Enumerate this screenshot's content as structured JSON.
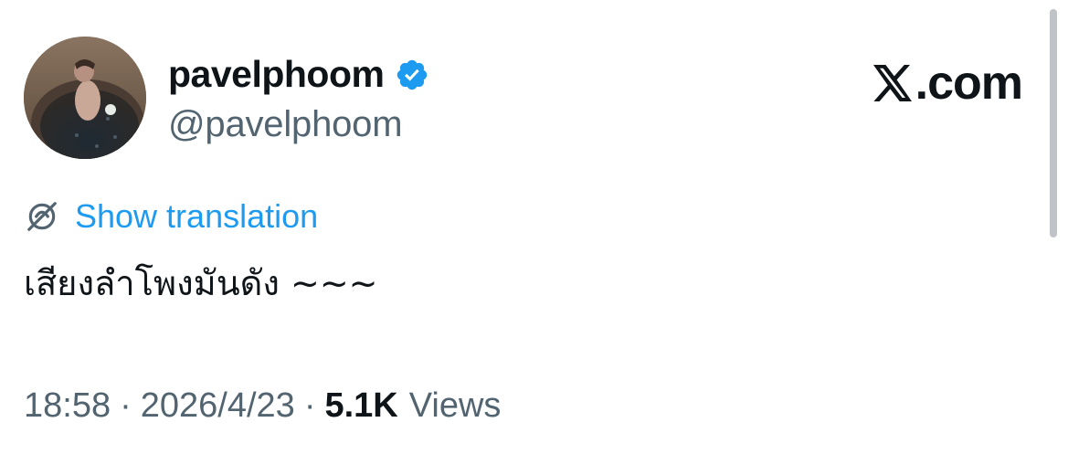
{
  "author": {
    "display_name": "pavelphoom",
    "handle": "@pavelphoom",
    "verified": true,
    "avatar_icon": "profile-photo"
  },
  "brand": {
    "domain": ".com",
    "logo_icon": "x-logo-icon"
  },
  "translation": {
    "link_label": "Show translation",
    "icon": "globe-icon"
  },
  "tweet": {
    "text": "เสียงลำโพงมันดัง ~~~"
  },
  "meta": {
    "time": "18:58",
    "separator": "·",
    "date": "2026/4/23",
    "views_count": "5.1K",
    "views_label": "Views"
  },
  "colors": {
    "link_blue": "#1d9bf0",
    "verified_blue": "#1d9bf0",
    "secondary_text": "#536471",
    "primary_text": "#0f1419"
  }
}
